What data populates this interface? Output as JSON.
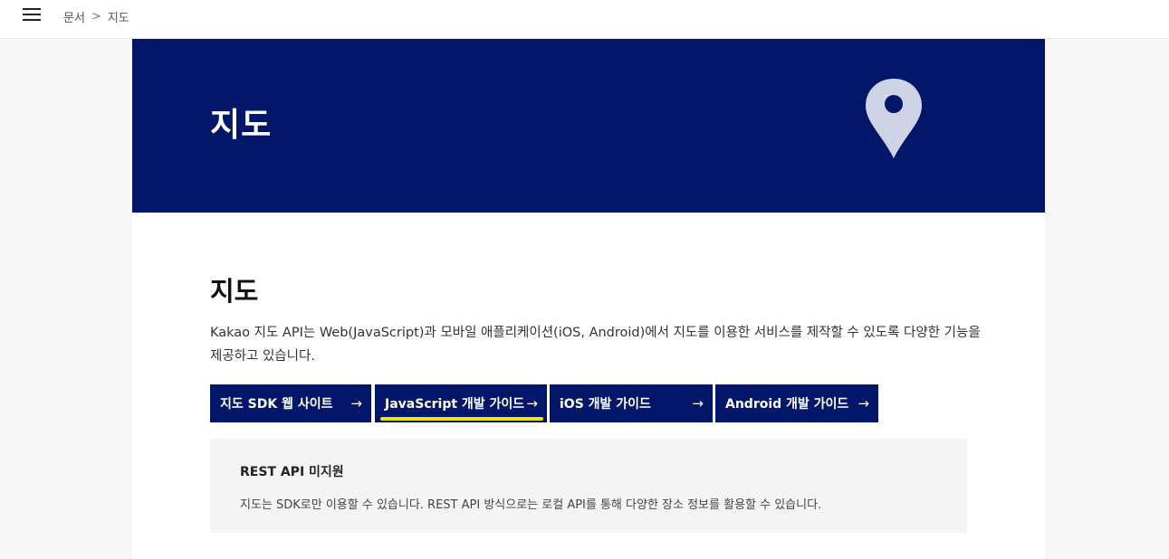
{
  "topbar": {
    "menu_icon": "hamburger-menu-icon",
    "breadcrumb": [
      "문서",
      "지도"
    ],
    "breadcrumb_separator": ">"
  },
  "hero": {
    "title": "지도",
    "icon": "map-pin-icon",
    "background_color": "#03176a",
    "icon_color": "#cfd3e6"
  },
  "main": {
    "title": "지도",
    "description": "Kakao 지도 API는 Web(JavaScript)과 모바일 애플리케이션(iOS, Android)에서 지도를 이용한 서비스를 제작할 수 있도록 다양한 기능을 제공하고 있습니다.",
    "buttons": [
      {
        "label": "지도 SDK 웹 사이트",
        "arrow": "→"
      },
      {
        "label": "JavaScript 개발 가이드",
        "arrow": "→"
      },
      {
        "label": "iOS 개발 가이드",
        "arrow": "→"
      },
      {
        "label": "Android 개발 가이드",
        "arrow": "→"
      }
    ],
    "highlight_color": "#f2e600"
  },
  "notice": {
    "title": "REST API 미지원",
    "text": "지도는 SDK로만 이용할 수 있습니다. REST API 방식으로는 로컬 API를 통해 다양한 장소 정보를 활용할 수 있습니다."
  }
}
